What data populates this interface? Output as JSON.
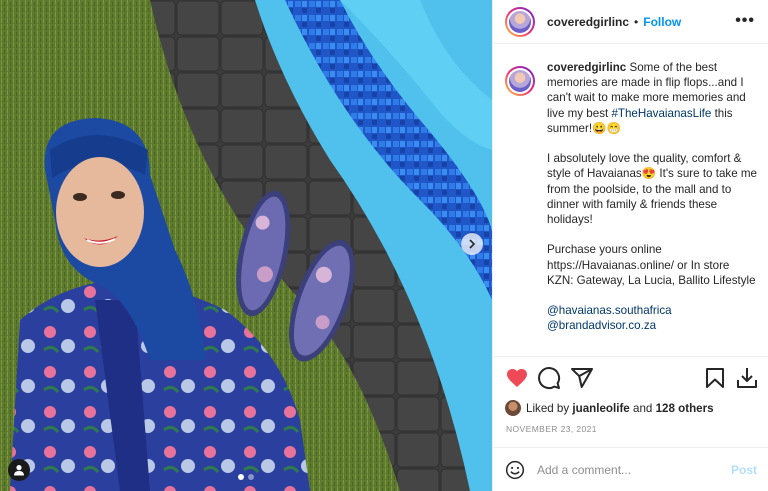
{
  "post": {
    "username": "coveredgirlinc",
    "separator": "•",
    "follow_label": "Follow",
    "more_label": "•••",
    "caption": {
      "username": "coveredgirlinc",
      "p1_text": "Some of the best memories are made in flip flops...and I can't wait to make more memories and live my best ",
      "p1_hashtag": "#TheHavaianasLife",
      "p1_end": " this summer!😀😁",
      "p2": "I absolutely love the quality, comfort & style of Havaianas😍 It's sure to take me from the poolside, to the mall and to dinner with family & friends these holidays!",
      "p3_line1": "Purchase yours online https://Havaianas.online/ or In store KZN: Gateway, La Lucia, Ballito Lifestyle",
      "mention1": "@havaianas.southafrica",
      "mention2": "@brandadvisor.co.za"
    },
    "likes": {
      "prefix": "Liked by ",
      "user": "juanleolife",
      "middle": " and ",
      "others": "128 others"
    },
    "date": "NOVEMBER 23, 2021",
    "comment": {
      "placeholder": "Add a comment...",
      "post_label": "Post"
    },
    "carousel": {
      "slide_count": 2,
      "active_index": 0
    },
    "icons": {
      "like": "heart-icon",
      "comment": "comment-icon",
      "share": "share-icon",
      "save": "bookmark-icon",
      "download": "download-icon",
      "emoji": "emoji-icon",
      "next": "chevron-right-icon",
      "tags": "user-tag-icon"
    },
    "colors": {
      "accent": "#0095f6",
      "liked": "#ed4956",
      "link": "#00376b",
      "muted": "#8e8e8e"
    }
  }
}
